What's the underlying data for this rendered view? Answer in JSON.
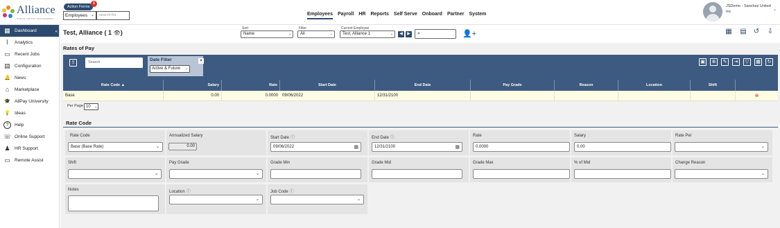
{
  "logo": {
    "name": "Alliance",
    "tagline": "HUMAN CAPITAL MANAGEMENT"
  },
  "action_forms": {
    "label": "Action Forms",
    "badge": "1"
  },
  "employee_select": {
    "value": "Employees"
  },
  "search_for": {
    "placeholder": "search for"
  },
  "topnav": [
    "Employees",
    "Payroll",
    "HR",
    "Reports",
    "Self Serve",
    "Onboard",
    "Partner",
    "System"
  ],
  "user": {
    "name": "JSDemo - Sanchez United Inc"
  },
  "sidebar": {
    "items": [
      {
        "label": "Dashboard",
        "icon": "dashboard-icon",
        "glyph": "▦"
      },
      {
        "label": "Analytics",
        "icon": "analytics-icon",
        "glyph": "⌇"
      },
      {
        "label": "Recent Jobs",
        "icon": "recent-jobs-icon",
        "glyph": "▭"
      },
      {
        "label": "Configuration",
        "icon": "configuration-icon",
        "glyph": "▤"
      },
      {
        "label": "News",
        "icon": "news-icon",
        "glyph": "🔔"
      },
      {
        "label": "Marketplace",
        "icon": "marketplace-icon",
        "glyph": "⌂"
      },
      {
        "label": "AllPay University",
        "icon": "university-icon",
        "glyph": "🎓"
      },
      {
        "label": "Ideas",
        "icon": "ideas-icon",
        "glyph": "💡"
      },
      {
        "label": "Help",
        "icon": "help-icon",
        "glyph": "?"
      },
      {
        "label": "Online Support",
        "icon": "online-support-icon",
        "glyph": "☏"
      },
      {
        "label": "HR Support",
        "icon": "hr-support-icon",
        "glyph": "♟"
      },
      {
        "label": "Remote Assist",
        "icon": "remote-assist-icon",
        "glyph": "▭"
      }
    ]
  },
  "page": {
    "title": "Test, Alliance ( 1 ",
    "sort": {
      "label": "Sort",
      "value": "Name"
    },
    "filter": {
      "label": "Filter",
      "value": "All"
    },
    "current_employee": {
      "label": "Current Employee",
      "value": "Test, Alliance 1"
    }
  },
  "rates": {
    "title": "Rates of Pay",
    "search_placeholder": "Search",
    "date_filter": {
      "label": "Date Filter",
      "value": "Active & Future"
    },
    "columns": [
      "Rate Code ▲",
      "Salary",
      "Rate",
      "Start Date",
      "End Date",
      "Pay Grade",
      "Reason",
      "Location",
      "Shift"
    ],
    "row": {
      "rate_code": "Base",
      "salary": "0.00",
      "rate": "0.0000",
      "start_date": "09/06/2022",
      "end_date": "12/31/2100",
      "pay_grade": "",
      "reason": "",
      "location": "",
      "shift": ""
    },
    "per_page_label": "Per Page",
    "per_page_value": "10"
  },
  "rate_code_form": {
    "title": "Rate Code",
    "rate_code": {
      "label": "Rate Code",
      "value": "Base (Base Rate)"
    },
    "annualized_salary": {
      "label": "Annualized Salary",
      "value": "0.00"
    },
    "start_date": {
      "label": "Start Date",
      "value": "09/06/2022"
    },
    "end_date": {
      "label": "End Date",
      "value": "12/31/2100"
    },
    "rate": {
      "label": "Rate",
      "value": "0.0000"
    },
    "salary": {
      "label": "Salary",
      "value": "0.00"
    },
    "rate_per": {
      "label": "Rate Per",
      "value": ""
    },
    "shift": {
      "label": "Shift",
      "value": ""
    },
    "pay_grade": {
      "label": "Pay Grade",
      "value": ""
    },
    "grade_min": {
      "label": "Grade Min",
      "value": ""
    },
    "grade_mid": {
      "label": "Grade Mid",
      "value": ""
    },
    "grade_max": {
      "label": "Grade Max",
      "value": ""
    },
    "pct_of_mid": {
      "label": "% of Mid",
      "value": ""
    },
    "change_reason": {
      "label": "Change Reason",
      "value": ""
    },
    "notes": {
      "label": "Notes",
      "value": ""
    },
    "location": {
      "label": "Location",
      "value": ""
    },
    "job_code": {
      "label": "Job Code",
      "value": ""
    }
  },
  "colors": {
    "brand": "#2c4a6e",
    "grid_header": "#3d5a80",
    "badge": "#d9312b",
    "row_highlight": "#fdfde3"
  }
}
